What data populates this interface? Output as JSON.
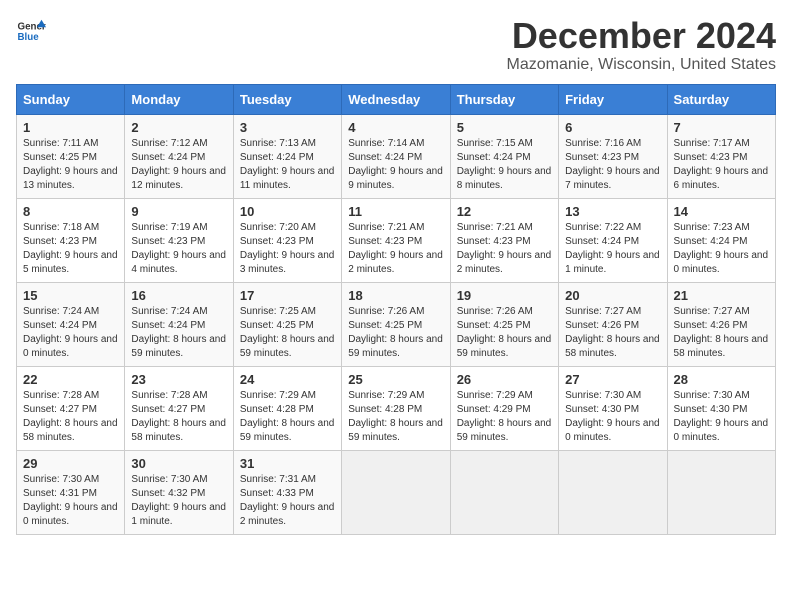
{
  "logo": {
    "general": "General",
    "blue": "Blue"
  },
  "title": "December 2024",
  "subtitle": "Mazomanie, Wisconsin, United States",
  "days_of_week": [
    "Sunday",
    "Monday",
    "Tuesday",
    "Wednesday",
    "Thursday",
    "Friday",
    "Saturday"
  ],
  "weeks": [
    [
      {
        "day": "1",
        "sunrise": "7:11 AM",
        "sunset": "4:25 PM",
        "daylight": "9 hours and 13 minutes."
      },
      {
        "day": "2",
        "sunrise": "7:12 AM",
        "sunset": "4:24 PM",
        "daylight": "9 hours and 12 minutes."
      },
      {
        "day": "3",
        "sunrise": "7:13 AM",
        "sunset": "4:24 PM",
        "daylight": "9 hours and 11 minutes."
      },
      {
        "day": "4",
        "sunrise": "7:14 AM",
        "sunset": "4:24 PM",
        "daylight": "9 hours and 9 minutes."
      },
      {
        "day": "5",
        "sunrise": "7:15 AM",
        "sunset": "4:24 PM",
        "daylight": "9 hours and 8 minutes."
      },
      {
        "day": "6",
        "sunrise": "7:16 AM",
        "sunset": "4:23 PM",
        "daylight": "9 hours and 7 minutes."
      },
      {
        "day": "7",
        "sunrise": "7:17 AM",
        "sunset": "4:23 PM",
        "daylight": "9 hours and 6 minutes."
      }
    ],
    [
      {
        "day": "8",
        "sunrise": "7:18 AM",
        "sunset": "4:23 PM",
        "daylight": "9 hours and 5 minutes."
      },
      {
        "day": "9",
        "sunrise": "7:19 AM",
        "sunset": "4:23 PM",
        "daylight": "9 hours and 4 minutes."
      },
      {
        "day": "10",
        "sunrise": "7:20 AM",
        "sunset": "4:23 PM",
        "daylight": "9 hours and 3 minutes."
      },
      {
        "day": "11",
        "sunrise": "7:21 AM",
        "sunset": "4:23 PM",
        "daylight": "9 hours and 2 minutes."
      },
      {
        "day": "12",
        "sunrise": "7:21 AM",
        "sunset": "4:23 PM",
        "daylight": "9 hours and 2 minutes."
      },
      {
        "day": "13",
        "sunrise": "7:22 AM",
        "sunset": "4:24 PM",
        "daylight": "9 hours and 1 minute."
      },
      {
        "day": "14",
        "sunrise": "7:23 AM",
        "sunset": "4:24 PM",
        "daylight": "9 hours and 0 minutes."
      }
    ],
    [
      {
        "day": "15",
        "sunrise": "7:24 AM",
        "sunset": "4:24 PM",
        "daylight": "9 hours and 0 minutes."
      },
      {
        "day": "16",
        "sunrise": "7:24 AM",
        "sunset": "4:24 PM",
        "daylight": "8 hours and 59 minutes."
      },
      {
        "day": "17",
        "sunrise": "7:25 AM",
        "sunset": "4:25 PM",
        "daylight": "8 hours and 59 minutes."
      },
      {
        "day": "18",
        "sunrise": "7:26 AM",
        "sunset": "4:25 PM",
        "daylight": "8 hours and 59 minutes."
      },
      {
        "day": "19",
        "sunrise": "7:26 AM",
        "sunset": "4:25 PM",
        "daylight": "8 hours and 59 minutes."
      },
      {
        "day": "20",
        "sunrise": "7:27 AM",
        "sunset": "4:26 PM",
        "daylight": "8 hours and 58 minutes."
      },
      {
        "day": "21",
        "sunrise": "7:27 AM",
        "sunset": "4:26 PM",
        "daylight": "8 hours and 58 minutes."
      }
    ],
    [
      {
        "day": "22",
        "sunrise": "7:28 AM",
        "sunset": "4:27 PM",
        "daylight": "8 hours and 58 minutes."
      },
      {
        "day": "23",
        "sunrise": "7:28 AM",
        "sunset": "4:27 PM",
        "daylight": "8 hours and 58 minutes."
      },
      {
        "day": "24",
        "sunrise": "7:29 AM",
        "sunset": "4:28 PM",
        "daylight": "8 hours and 59 minutes."
      },
      {
        "day": "25",
        "sunrise": "7:29 AM",
        "sunset": "4:28 PM",
        "daylight": "8 hours and 59 minutes."
      },
      {
        "day": "26",
        "sunrise": "7:29 AM",
        "sunset": "4:29 PM",
        "daylight": "8 hours and 59 minutes."
      },
      {
        "day": "27",
        "sunrise": "7:30 AM",
        "sunset": "4:30 PM",
        "daylight": "9 hours and 0 minutes."
      },
      {
        "day": "28",
        "sunrise": "7:30 AM",
        "sunset": "4:30 PM",
        "daylight": "9 hours and 0 minutes."
      }
    ],
    [
      {
        "day": "29",
        "sunrise": "7:30 AM",
        "sunset": "4:31 PM",
        "daylight": "9 hours and 0 minutes."
      },
      {
        "day": "30",
        "sunrise": "7:30 AM",
        "sunset": "4:32 PM",
        "daylight": "9 hours and 1 minute."
      },
      {
        "day": "31",
        "sunrise": "7:31 AM",
        "sunset": "4:33 PM",
        "daylight": "9 hours and 2 minutes."
      },
      null,
      null,
      null,
      null
    ]
  ],
  "labels": {
    "sunrise": "Sunrise:",
    "sunset": "Sunset:",
    "daylight": "Daylight:"
  }
}
